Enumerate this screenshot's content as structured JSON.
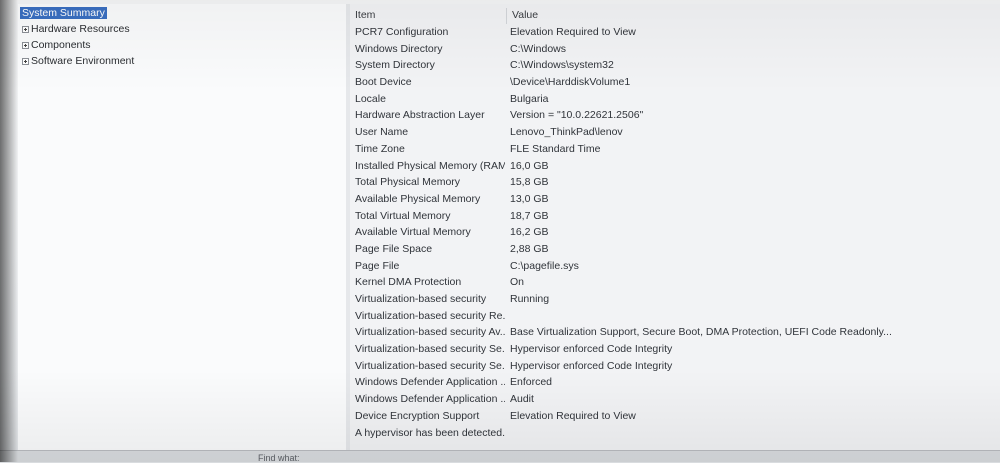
{
  "tree": {
    "items": [
      {
        "label": "System Summary",
        "selected": true,
        "expandable": false
      },
      {
        "label": "Hardware Resources",
        "selected": false,
        "expandable": true
      },
      {
        "label": "Components",
        "selected": false,
        "expandable": true
      },
      {
        "label": "Software Environment",
        "selected": false,
        "expandable": true
      }
    ]
  },
  "list": {
    "columns": {
      "item": "Item",
      "value": "Value"
    },
    "rows": [
      {
        "item": "PCR7 Configuration",
        "value": "Elevation Required to View"
      },
      {
        "item": "Windows Directory",
        "value": "C:\\Windows"
      },
      {
        "item": "System Directory",
        "value": "C:\\Windows\\system32"
      },
      {
        "item": "Boot Device",
        "value": "\\Device\\HarddiskVolume1"
      },
      {
        "item": "Locale",
        "value": "Bulgaria"
      },
      {
        "item": "Hardware Abstraction Layer",
        "value": "Version = \"10.0.22621.2506\""
      },
      {
        "item": "User Name",
        "value": "Lenovo_ThinkPad\\lenov"
      },
      {
        "item": "Time Zone",
        "value": "FLE Standard Time"
      },
      {
        "item": "Installed Physical Memory (RAM)",
        "value": "16,0 GB"
      },
      {
        "item": "Total Physical Memory",
        "value": "15,8 GB"
      },
      {
        "item": "Available Physical Memory",
        "value": "13,0 GB"
      },
      {
        "item": "Total Virtual Memory",
        "value": "18,7 GB"
      },
      {
        "item": "Available Virtual Memory",
        "value": "16,2 GB"
      },
      {
        "item": "Page File Space",
        "value": "2,88 GB"
      },
      {
        "item": "Page File",
        "value": "C:\\pagefile.sys"
      },
      {
        "item": "Kernel DMA Protection",
        "value": "On"
      },
      {
        "item": "Virtualization-based security",
        "value": "Running"
      },
      {
        "item": "Virtualization-based security Re...",
        "value": ""
      },
      {
        "item": "Virtualization-based security Av...",
        "value": "Base Virtualization Support, Secure Boot, DMA Protection, UEFI Code Readonly..."
      },
      {
        "item": "Virtualization-based security Se...",
        "value": "Hypervisor enforced Code Integrity"
      },
      {
        "item": "Virtualization-based security Se...",
        "value": "Hypervisor enforced Code Integrity"
      },
      {
        "item": "Windows Defender Application ...",
        "value": "Enforced"
      },
      {
        "item": "Windows Defender Application ...",
        "value": "Audit"
      },
      {
        "item": "Device Encryption Support",
        "value": "Elevation Required to View"
      },
      {
        "item": "A hypervisor has been detected...",
        "value": ""
      }
    ]
  },
  "find": {
    "label": "Find what:"
  },
  "colors": {
    "selection": "#3a6fc1"
  }
}
